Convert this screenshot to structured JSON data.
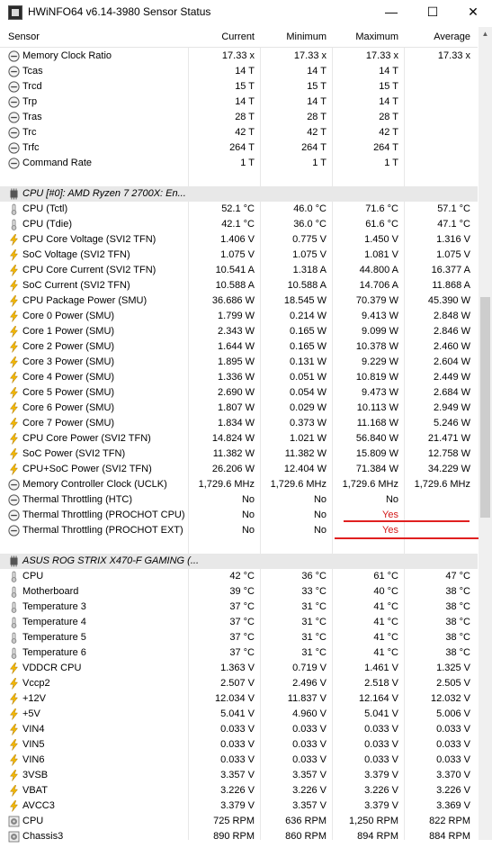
{
  "window": {
    "title": "HWiNFO64 v6.14-3980 Sensor Status",
    "minimize_label": "—",
    "maximize_label": "☐",
    "close_label": "✕"
  },
  "columns": {
    "sensor": "Sensor",
    "current": "Current",
    "minimum": "Minimum",
    "maximum": "Maximum",
    "average": "Average"
  },
  "colors": {
    "group_bg": "#e8e8e8",
    "alert": "#d21919",
    "underline": "#e02020"
  },
  "rows": [
    {
      "type": "item",
      "icon": "clock",
      "name": "Memory Clock Ratio",
      "cur": "17.33 x",
      "min": "17.33 x",
      "max": "17.33 x",
      "avg": "17.33 x"
    },
    {
      "type": "item",
      "icon": "clock",
      "name": "Tcas",
      "cur": "14 T",
      "min": "14 T",
      "max": "14 T",
      "avg": ""
    },
    {
      "type": "item",
      "icon": "clock",
      "name": "Trcd",
      "cur": "15 T",
      "min": "15 T",
      "max": "15 T",
      "avg": ""
    },
    {
      "type": "item",
      "icon": "clock",
      "name": "Trp",
      "cur": "14 T",
      "min": "14 T",
      "max": "14 T",
      "avg": ""
    },
    {
      "type": "item",
      "icon": "clock",
      "name": "Tras",
      "cur": "28 T",
      "min": "28 T",
      "max": "28 T",
      "avg": ""
    },
    {
      "type": "item",
      "icon": "clock",
      "name": "Trc",
      "cur": "42 T",
      "min": "42 T",
      "max": "42 T",
      "avg": ""
    },
    {
      "type": "item",
      "icon": "clock",
      "name": "Trfc",
      "cur": "264 T",
      "min": "264 T",
      "max": "264 T",
      "avg": ""
    },
    {
      "type": "item",
      "icon": "clock",
      "name": "Command Rate",
      "cur": "1 T",
      "min": "1 T",
      "max": "1 T",
      "avg": ""
    },
    {
      "type": "blank"
    },
    {
      "type": "group",
      "icon": "chip",
      "name": "CPU [#0]: AMD Ryzen 7 2700X: En..."
    },
    {
      "type": "item",
      "icon": "thermo",
      "name": "CPU (Tctl)",
      "cur": "52.1 °C",
      "min": "46.0 °C",
      "max": "71.6 °C",
      "avg": "57.1 °C"
    },
    {
      "type": "item",
      "icon": "thermo",
      "name": "CPU (Tdie)",
      "cur": "42.1 °C",
      "min": "36.0 °C",
      "max": "61.6 °C",
      "avg": "47.1 °C"
    },
    {
      "type": "item",
      "icon": "bolt",
      "name": "CPU Core Voltage (SVI2 TFN)",
      "cur": "1.406 V",
      "min": "0.775 V",
      "max": "1.450 V",
      "avg": "1.316 V"
    },
    {
      "type": "item",
      "icon": "bolt",
      "name": "SoC Voltage (SVI2 TFN)",
      "cur": "1.075 V",
      "min": "1.075 V",
      "max": "1.081 V",
      "avg": "1.075 V"
    },
    {
      "type": "item",
      "icon": "bolt",
      "name": "CPU Core Current (SVI2 TFN)",
      "cur": "10.541 A",
      "min": "1.318 A",
      "max": "44.800 A",
      "avg": "16.377 A"
    },
    {
      "type": "item",
      "icon": "bolt",
      "name": "SoC Current (SVI2 TFN)",
      "cur": "10.588 A",
      "min": "10.588 A",
      "max": "14.706 A",
      "avg": "11.868 A"
    },
    {
      "type": "item",
      "icon": "bolt",
      "name": "CPU Package Power (SMU)",
      "cur": "36.686 W",
      "min": "18.545 W",
      "max": "70.379 W",
      "avg": "45.390 W"
    },
    {
      "type": "item",
      "icon": "bolt",
      "name": "Core 0 Power (SMU)",
      "cur": "1.799 W",
      "min": "0.214 W",
      "max": "9.413 W",
      "avg": "2.848 W"
    },
    {
      "type": "item",
      "icon": "bolt",
      "name": "Core 1 Power (SMU)",
      "cur": "2.343 W",
      "min": "0.165 W",
      "max": "9.099 W",
      "avg": "2.846 W"
    },
    {
      "type": "item",
      "icon": "bolt",
      "name": "Core 2 Power (SMU)",
      "cur": "1.644 W",
      "min": "0.165 W",
      "max": "10.378 W",
      "avg": "2.460 W"
    },
    {
      "type": "item",
      "icon": "bolt",
      "name": "Core 3 Power (SMU)",
      "cur": "1.895 W",
      "min": "0.131 W",
      "max": "9.229 W",
      "avg": "2.604 W"
    },
    {
      "type": "item",
      "icon": "bolt",
      "name": "Core 4 Power (SMU)",
      "cur": "1.336 W",
      "min": "0.051 W",
      "max": "10.819 W",
      "avg": "2.449 W"
    },
    {
      "type": "item",
      "icon": "bolt",
      "name": "Core 5 Power (SMU)",
      "cur": "2.690 W",
      "min": "0.054 W",
      "max": "9.473 W",
      "avg": "2.684 W"
    },
    {
      "type": "item",
      "icon": "bolt",
      "name": "Core 6 Power (SMU)",
      "cur": "1.807 W",
      "min": "0.029 W",
      "max": "10.113 W",
      "avg": "2.949 W"
    },
    {
      "type": "item",
      "icon": "bolt",
      "name": "Core 7 Power (SMU)",
      "cur": "1.834 W",
      "min": "0.373 W",
      "max": "11.168 W",
      "avg": "5.246 W"
    },
    {
      "type": "item",
      "icon": "bolt",
      "name": "CPU Core Power (SVI2 TFN)",
      "cur": "14.824 W",
      "min": "1.021 W",
      "max": "56.840 W",
      "avg": "21.471 W"
    },
    {
      "type": "item",
      "icon": "bolt",
      "name": "SoC Power (SVI2 TFN)",
      "cur": "11.382 W",
      "min": "11.382 W",
      "max": "15.809 W",
      "avg": "12.758 W"
    },
    {
      "type": "item",
      "icon": "bolt",
      "name": "CPU+SoC Power (SVI2 TFN)",
      "cur": "26.206 W",
      "min": "12.404 W",
      "max": "71.384 W",
      "avg": "34.229 W"
    },
    {
      "type": "item",
      "icon": "clock",
      "name": "Memory Controller Clock (UCLK)",
      "cur": "1,729.6 MHz",
      "min": "1,729.6 MHz",
      "max": "1,729.6 MHz",
      "avg": "1,729.6 MHz"
    },
    {
      "type": "item",
      "icon": "clock",
      "name": "Thermal Throttling (HTC)",
      "cur": "No",
      "min": "No",
      "max": "No",
      "avg": ""
    },
    {
      "type": "item",
      "icon": "clock",
      "name": "Thermal Throttling (PROCHOT CPU)",
      "cur": "No",
      "min": "No",
      "max": "Yes",
      "avg": "",
      "alert": true
    },
    {
      "type": "item",
      "icon": "clock",
      "name": "Thermal Throttling (PROCHOT EXT)",
      "cur": "No",
      "min": "No",
      "max": "Yes",
      "avg": "",
      "alert": true
    },
    {
      "type": "blank"
    },
    {
      "type": "group",
      "icon": "chip",
      "name": "ASUS ROG STRIX X470-F GAMING (..."
    },
    {
      "type": "item",
      "icon": "thermo",
      "name": "CPU",
      "cur": "42 °C",
      "min": "36 °C",
      "max": "61 °C",
      "avg": "47 °C"
    },
    {
      "type": "item",
      "icon": "thermo",
      "name": "Motherboard",
      "cur": "39 °C",
      "min": "33 °C",
      "max": "40 °C",
      "avg": "38 °C"
    },
    {
      "type": "item",
      "icon": "thermo",
      "name": "Temperature 3",
      "cur": "37 °C",
      "min": "31 °C",
      "max": "41 °C",
      "avg": "38 °C"
    },
    {
      "type": "item",
      "icon": "thermo",
      "name": "Temperature 4",
      "cur": "37 °C",
      "min": "31 °C",
      "max": "41 °C",
      "avg": "38 °C"
    },
    {
      "type": "item",
      "icon": "thermo",
      "name": "Temperature 5",
      "cur": "37 °C",
      "min": "31 °C",
      "max": "41 °C",
      "avg": "38 °C"
    },
    {
      "type": "item",
      "icon": "thermo",
      "name": "Temperature 6",
      "cur": "37 °C",
      "min": "31 °C",
      "max": "41 °C",
      "avg": "38 °C"
    },
    {
      "type": "item",
      "icon": "bolt",
      "name": "VDDCR CPU",
      "cur": "1.363 V",
      "min": "0.719 V",
      "max": "1.461 V",
      "avg": "1.325 V"
    },
    {
      "type": "item",
      "icon": "bolt",
      "name": "Vccp2",
      "cur": "2.507 V",
      "min": "2.496 V",
      "max": "2.518 V",
      "avg": "2.505 V"
    },
    {
      "type": "item",
      "icon": "bolt",
      "name": "+12V",
      "cur": "12.034 V",
      "min": "11.837 V",
      "max": "12.164 V",
      "avg": "12.032 V"
    },
    {
      "type": "item",
      "icon": "bolt",
      "name": "+5V",
      "cur": "5.041 V",
      "min": "4.960 V",
      "max": "5.041 V",
      "avg": "5.006 V"
    },
    {
      "type": "item",
      "icon": "bolt",
      "name": "VIN4",
      "cur": "0.033 V",
      "min": "0.033 V",
      "max": "0.033 V",
      "avg": "0.033 V"
    },
    {
      "type": "item",
      "icon": "bolt",
      "name": "VIN5",
      "cur": "0.033 V",
      "min": "0.033 V",
      "max": "0.033 V",
      "avg": "0.033 V"
    },
    {
      "type": "item",
      "icon": "bolt",
      "name": "VIN6",
      "cur": "0.033 V",
      "min": "0.033 V",
      "max": "0.033 V",
      "avg": "0.033 V"
    },
    {
      "type": "item",
      "icon": "bolt",
      "name": "3VSB",
      "cur": "3.357 V",
      "min": "3.357 V",
      "max": "3.379 V",
      "avg": "3.370 V"
    },
    {
      "type": "item",
      "icon": "bolt",
      "name": "VBAT",
      "cur": "3.226 V",
      "min": "3.226 V",
      "max": "3.226 V",
      "avg": "3.226 V"
    },
    {
      "type": "item",
      "icon": "bolt",
      "name": "AVCC3",
      "cur": "3.379 V",
      "min": "3.357 V",
      "max": "3.379 V",
      "avg": "3.369 V"
    },
    {
      "type": "item",
      "icon": "fan",
      "name": "CPU",
      "cur": "725 RPM",
      "min": "636 RPM",
      "max": "1,250 RPM",
      "avg": "822 RPM"
    },
    {
      "type": "item",
      "icon": "fan",
      "name": "Chassis3",
      "cur": "890 RPM",
      "min": "860 RPM",
      "max": "894 RPM",
      "avg": "884 RPM"
    }
  ]
}
